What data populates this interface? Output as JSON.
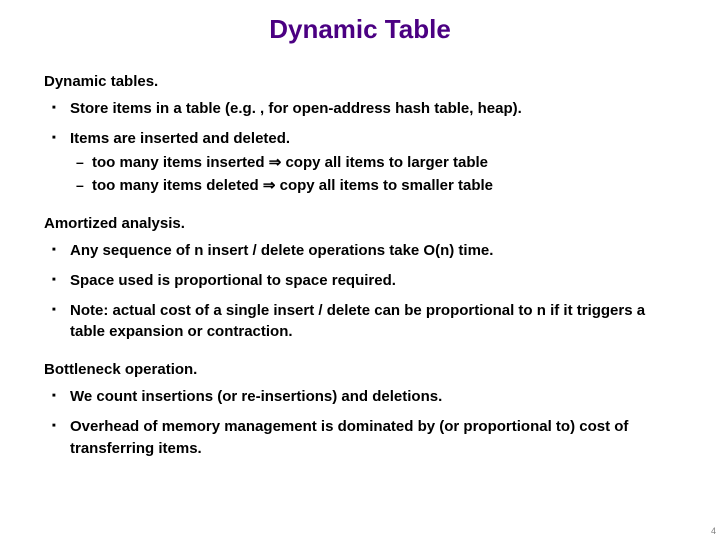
{
  "title": "Dynamic Table",
  "sections": [
    {
      "heading": "Dynamic tables.",
      "bullets": [
        {
          "text": "Store items in a table (e.g. , for open-address hash table, heap)."
        },
        {
          "text": "Items are inserted and deleted.",
          "sub": [
            "too many items inserted  ⇒  copy all items to larger table",
            "too many items deleted   ⇒  copy all items to smaller table"
          ]
        }
      ]
    },
    {
      "heading": "Amortized analysis.",
      "bullets": [
        {
          "text": "Any sequence of n insert / delete operations take O(n) time."
        },
        {
          "text": "Space used is proportional to space required."
        },
        {
          "text": "Note:  actual cost of a single insert / delete can be proportional to n if it triggers a table expansion or contraction."
        }
      ]
    },
    {
      "heading": "Bottleneck operation.",
      "bullets": [
        {
          "text": "We count insertions (or re-insertions) and deletions."
        },
        {
          "text": "Overhead of memory management is dominated by (or proportional to) cost of transferring items."
        }
      ]
    }
  ],
  "page_number": "4"
}
